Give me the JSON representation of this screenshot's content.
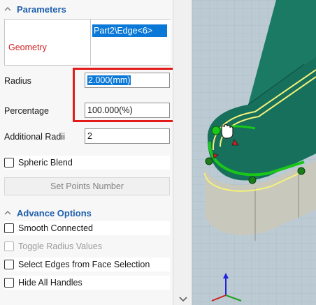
{
  "parameters": {
    "title": "Parameters",
    "geometry_label": "Geometry",
    "geometry_item": "Part2\\Edge<6>",
    "radius_label": "Radius",
    "radius_value": "2.000(mm)",
    "percentage_label": "Percentage",
    "percentage_value": "100.000(%)",
    "additional_radii_label": "Additional Radii",
    "additional_radii_value": "2",
    "spheric_blend_label": "Spheric Blend",
    "spheric_blend_checked": false,
    "set_points_label": "Set Points Number"
  },
  "advance_options": {
    "title": "Advance Options",
    "items": [
      {
        "label": "Smooth Connected",
        "checked": false,
        "enabled": true
      },
      {
        "label": "Toggle Radius Values",
        "checked": false,
        "enabled": false
      },
      {
        "label": "Select Edges from Face Selection",
        "checked": false,
        "enabled": true
      },
      {
        "label": "Hide All Handles",
        "checked": false,
        "enabled": true
      }
    ]
  },
  "colors": {
    "accent_blue": "#1f5fae",
    "selection_blue": "#0a78d7",
    "required_red": "#d21f1f",
    "highlight_red": "#e41b1b",
    "model_top": "#156b58",
    "model_side": "#bdbdb0",
    "edge_green": "#19c619"
  }
}
